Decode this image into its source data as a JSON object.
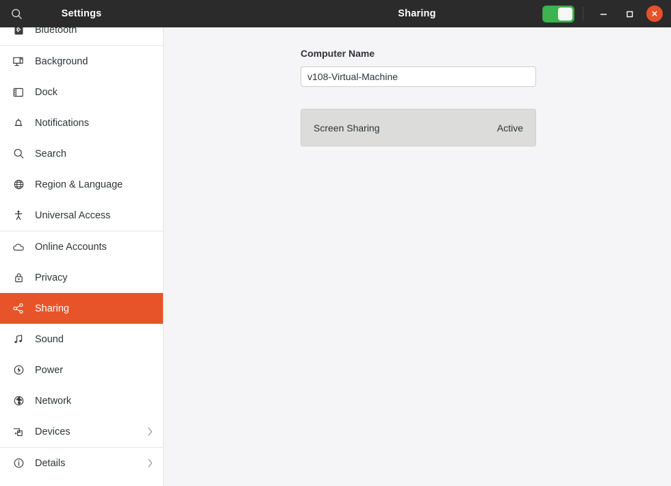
{
  "titlebar": {
    "settings_label": "Settings",
    "page_title": "Sharing",
    "search_icon": "search-icon",
    "toggle_state": "on",
    "minimize_label": "–",
    "maximize_label": "□",
    "close_label": "✕",
    "toggle_color": "#3eb34f",
    "close_color": "#e6512a",
    "bar_color": "#2b2b2b"
  },
  "sidebar": {
    "accent_color": "#e8542a",
    "items": [
      {
        "label": "Bluetooth",
        "icon": "bluetooth-icon",
        "selected": false,
        "chevron": false,
        "separator_after": true
      },
      {
        "label": "Background",
        "icon": "background-icon",
        "selected": false,
        "chevron": false,
        "separator_after": false
      },
      {
        "label": "Dock",
        "icon": "dock-icon",
        "selected": false,
        "chevron": false,
        "separator_after": false
      },
      {
        "label": "Notifications",
        "icon": "bell-icon",
        "selected": false,
        "chevron": false,
        "separator_after": false
      },
      {
        "label": "Search",
        "icon": "search-icon",
        "selected": false,
        "chevron": false,
        "separator_after": false
      },
      {
        "label": "Region & Language",
        "icon": "globe-icon",
        "selected": false,
        "chevron": false,
        "separator_after": false
      },
      {
        "label": "Universal Access",
        "icon": "accessibility-icon",
        "selected": false,
        "chevron": false,
        "separator_after": true
      },
      {
        "label": "Online Accounts",
        "icon": "cloud-icon",
        "selected": false,
        "chevron": false,
        "separator_after": false
      },
      {
        "label": "Privacy",
        "icon": "lock-icon",
        "selected": false,
        "chevron": false,
        "separator_after": false
      },
      {
        "label": "Sharing",
        "icon": "share-icon",
        "selected": true,
        "chevron": false,
        "separator_after": false
      },
      {
        "label": "Sound",
        "icon": "music-note-icon",
        "selected": false,
        "chevron": false,
        "separator_after": false
      },
      {
        "label": "Power",
        "icon": "power-bolt-icon",
        "selected": false,
        "chevron": false,
        "separator_after": false
      },
      {
        "label": "Network",
        "icon": "network-globe-icon",
        "selected": false,
        "chevron": false,
        "separator_after": false
      },
      {
        "label": "Devices",
        "icon": "devices-icon",
        "selected": false,
        "chevron": true,
        "separator_after": true
      },
      {
        "label": "Details",
        "icon": "info-icon",
        "selected": false,
        "chevron": true,
        "separator_after": false
      }
    ]
  },
  "main": {
    "computer_name_label": "Computer Name",
    "computer_name_value": "v108-Virtual-Machine",
    "computer_name_placeholder": "Computer Name",
    "rows": [
      {
        "name": "Screen Sharing",
        "state": "Active"
      }
    ]
  }
}
